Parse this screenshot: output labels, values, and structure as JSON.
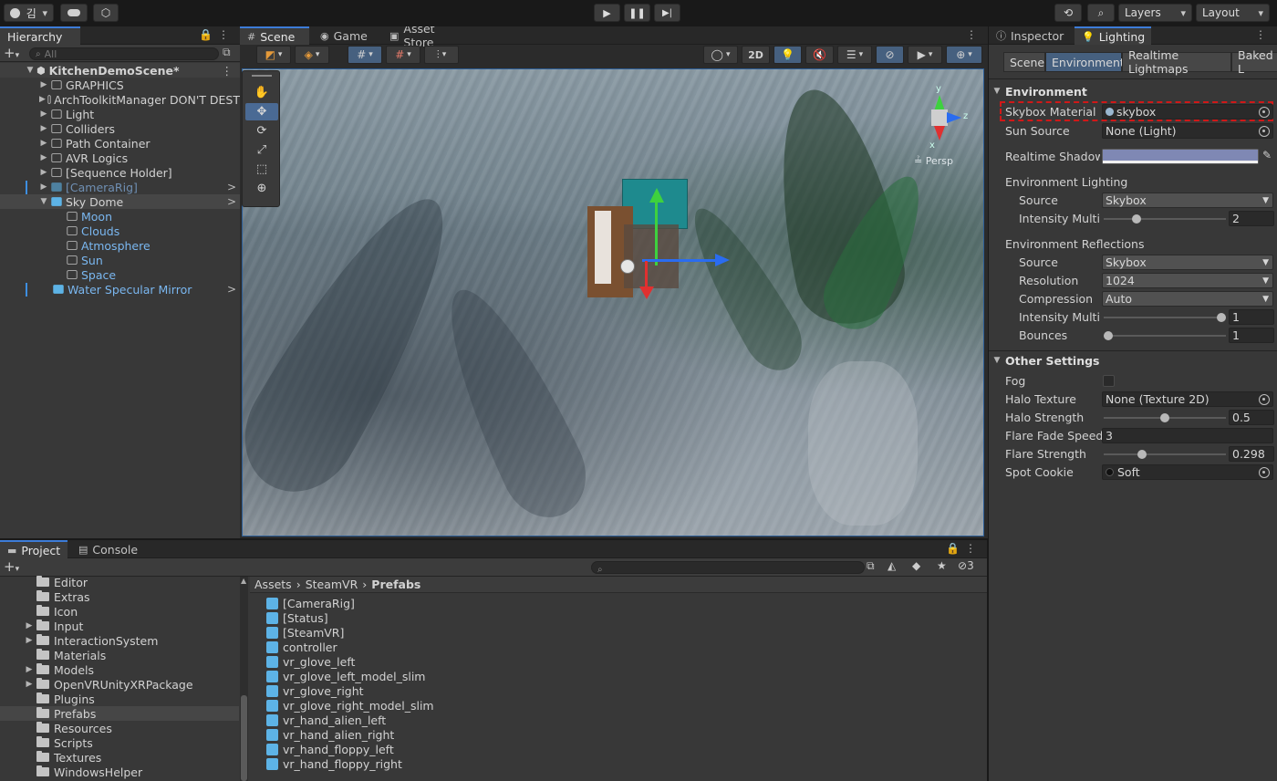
{
  "toolbar": {
    "account_label": "김",
    "layers_label": "Layers",
    "layout_label": "Layout"
  },
  "hierarchy": {
    "tab_label": "Hierarchy",
    "search_placeholder": "All",
    "scene_name": "KitchenDemoScene*",
    "items": [
      {
        "label": "GRAPHICS"
      },
      {
        "label": "ArchToolkitManager DON'T DEST"
      },
      {
        "label": "Light"
      },
      {
        "label": "Colliders"
      },
      {
        "label": "Path Container"
      },
      {
        "label": "AVR Logics"
      },
      {
        "label": "[Sequence Holder]"
      },
      {
        "label": "[CameraRig]"
      },
      {
        "label": "Sky Dome"
      },
      {
        "label": "Moon"
      },
      {
        "label": "Clouds"
      },
      {
        "label": "Atmosphere"
      },
      {
        "label": "Sun"
      },
      {
        "label": "Space"
      },
      {
        "label": "Water Specular Mirror"
      }
    ]
  },
  "scene": {
    "tabs": [
      {
        "label": "Scene"
      },
      {
        "label": "Game"
      },
      {
        "label": "Asset Store"
      }
    ],
    "mode_2d_label": "2D",
    "persp_label": "Persp",
    "gizmo_axes": {
      "x": "x",
      "y": "y",
      "z": "z"
    }
  },
  "inspector": {
    "tabs": [
      {
        "label": "Inspector"
      },
      {
        "label": "Lighting"
      }
    ],
    "subtabs": [
      {
        "label": "Scene"
      },
      {
        "label": "Environment"
      },
      {
        "label": "Realtime Lightmaps"
      },
      {
        "label": "Baked L"
      }
    ],
    "environment_header": "Environment",
    "skybox_material_label": "Skybox Material",
    "skybox_material_value": "skybox",
    "sun_source_label": "Sun Source",
    "sun_source_value": "None (Light)",
    "realtime_shadow_label": "Realtime Shadow C",
    "realtime_shadow_color": "#7f88b4",
    "env_lighting_header": "Environment Lighting",
    "env_lighting_source_label": "Source",
    "env_lighting_source_value": "Skybox",
    "env_lighting_intensity_label": "Intensity Multipl",
    "env_lighting_intensity_value": "2",
    "env_lighting_intensity_fraction": 0.25,
    "env_reflections_header": "Environment Reflections",
    "env_reflections_source_label": "Source",
    "env_reflections_source_value": "Skybox",
    "resolution_label": "Resolution",
    "resolution_value": "1024",
    "compression_label": "Compression",
    "compression_value": "Auto",
    "env_reflections_intensity_label": "Intensity Multipl",
    "env_reflections_intensity_value": "1",
    "env_reflections_intensity_fraction": 1.0,
    "bounces_label": "Bounces",
    "bounces_value": "1",
    "bounces_fraction": 0.0,
    "other_settings_header": "Other Settings",
    "fog_label": "Fog",
    "fog_checked": false,
    "halo_texture_label": "Halo Texture",
    "halo_texture_value": "None (Texture 2D)",
    "halo_strength_label": "Halo Strength",
    "halo_strength_value": "0.5",
    "halo_strength_fraction": 0.5,
    "flare_fade_speed_label": "Flare Fade Speed",
    "flare_fade_speed_value": "3",
    "flare_strength_label": "Flare Strength",
    "flare_strength_value": "0.298",
    "flare_strength_fraction": 0.3,
    "spot_cookie_label": "Spot Cookie",
    "spot_cookie_value": "Soft"
  },
  "project": {
    "tabs": [
      {
        "label": "Project"
      },
      {
        "label": "Console"
      }
    ],
    "hidden_count": "3",
    "folders": [
      {
        "label": "Editor",
        "expandable": false
      },
      {
        "label": "Extras",
        "expandable": false
      },
      {
        "label": "Icon",
        "expandable": false
      },
      {
        "label": "Input",
        "expandable": true
      },
      {
        "label": "InteractionSystem",
        "expandable": true
      },
      {
        "label": "Materials",
        "expandable": false
      },
      {
        "label": "Models",
        "expandable": true
      },
      {
        "label": "OpenVRUnityXRPackage",
        "expandable": true
      },
      {
        "label": "Plugins",
        "expandable": false
      },
      {
        "label": "Prefabs",
        "expandable": false
      },
      {
        "label": "Resources",
        "expandable": false
      },
      {
        "label": "Scripts",
        "expandable": false
      },
      {
        "label": "Textures",
        "expandable": false
      },
      {
        "label": "WindowsHelper",
        "expandable": false
      }
    ],
    "breadcrumb": [
      "Assets",
      "SteamVR",
      "Prefabs"
    ],
    "assets": [
      {
        "label": "[CameraRig]"
      },
      {
        "label": "[Status]"
      },
      {
        "label": "[SteamVR]"
      },
      {
        "label": "controller"
      },
      {
        "label": "vr_glove_left"
      },
      {
        "label": "vr_glove_left_model_slim"
      },
      {
        "label": "vr_glove_right"
      },
      {
        "label": "vr_glove_right_model_slim"
      },
      {
        "label": "vr_hand_alien_left"
      },
      {
        "label": "vr_hand_alien_right"
      },
      {
        "label": "vr_hand_floppy_left"
      },
      {
        "label": "vr_hand_floppy_right"
      }
    ]
  }
}
